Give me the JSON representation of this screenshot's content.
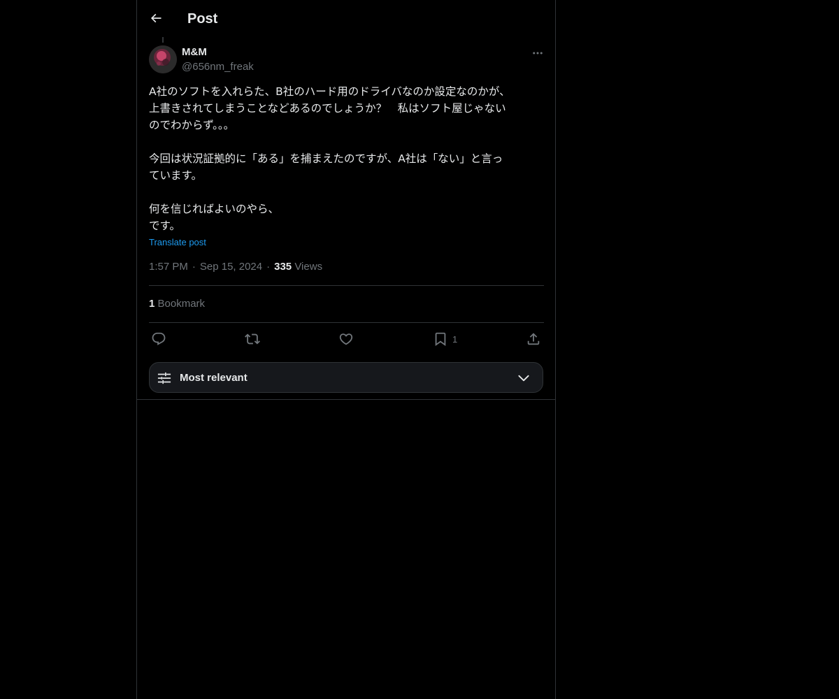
{
  "header": {
    "title": "Post",
    "back_icon": "arrow-left-icon"
  },
  "author": {
    "display_name": "M&M",
    "handle": "@656nm_freak",
    "avatar_colors": [
      "#d8486e",
      "#8e2a4a",
      "#2a2a2a"
    ]
  },
  "post": {
    "text": "A社のソフトを入れらた、B社のハード用のドライバなのか設定なのかが、\n上書きされてしまうことなどあるのでしょうか？　私はソフト屋じゃない\nのでわからず。。。\n\n今回は状況証拠的に「ある」を捕まえたのですが、A社は「ない」と言っ\nています。\n\n何を信じればよいのやら、\nです。",
    "translate_label": "Translate post",
    "time": "1:57 PM",
    "date": "Sep 15, 2024",
    "separator": "·",
    "views_count": "335",
    "views_label": "Views"
  },
  "engagement": {
    "bookmark_count": "1",
    "bookmark_label": "Bookmark"
  },
  "actions": {
    "reply_icon": "reply-icon",
    "repost_icon": "repost-icon",
    "like_icon": "heart-icon",
    "bookmark_icon": "bookmark-icon",
    "bookmark_count": "1",
    "share_icon": "share-icon"
  },
  "sort": {
    "label": "Most relevant"
  },
  "colors": {
    "background": "#000000",
    "text_primary": "#e7e9ea",
    "text_secondary": "#71767b",
    "link": "#1d9bf0",
    "border": "#2f3336"
  }
}
